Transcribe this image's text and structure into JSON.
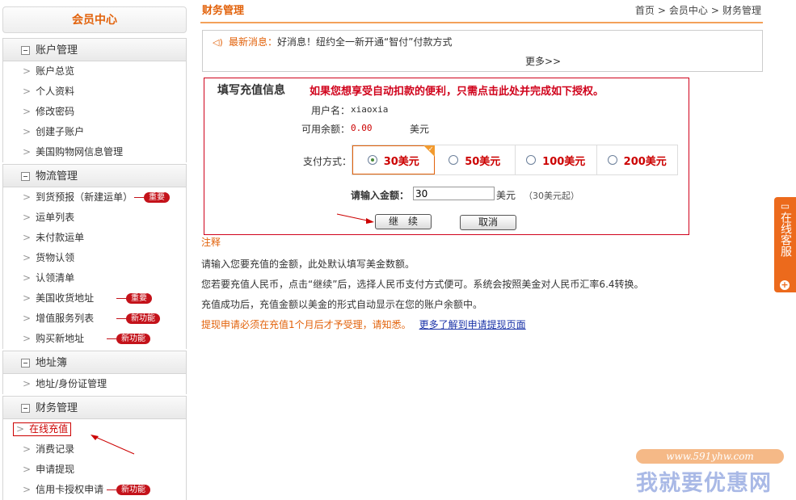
{
  "sidebar": {
    "title": "会员中心",
    "sections": [
      {
        "header": "账户管理",
        "items": [
          "账户总览",
          "个人资料",
          "修改密码",
          "创建子账户",
          "美国购物网信息管理"
        ]
      },
      {
        "header": "物流管理",
        "items": [
          "到货预报（新建运单）",
          "运单列表",
          "未付款运单",
          "货物认领",
          "认领清单",
          "美国收货地址",
          "增值服务列表",
          "购买新地址"
        ]
      },
      {
        "header": "地址簿",
        "items": [
          "地址/身份证管理"
        ]
      },
      {
        "header": "财务管理",
        "items": [
          "在线充值",
          "消费记录",
          "申请提现",
          "信用卡授权申请"
        ]
      }
    ],
    "badges": {
      "important": "重要",
      "new": "新功能"
    }
  },
  "page": {
    "title": "财务管理",
    "breadcrumb": [
      "首页",
      "会员中心",
      "财务管理"
    ]
  },
  "news": {
    "label": "最新消息：",
    "text": "好消息！纽约全一新开通“智付”付款方式",
    "more": "更多>>"
  },
  "form": {
    "title": "填写充值信息",
    "notice": "如果您想享受自动扣款的便利，只需点击此处并完成如下授权。",
    "username_label": "用户名：",
    "username": "xiaoxia",
    "balance_label": "可用余额：",
    "balance": "0.00",
    "balance_unit": "美元",
    "payment_label": "支付方式：",
    "options": [
      "30美元",
      "50美元",
      "100美元",
      "200美元"
    ],
    "selected_index": 0,
    "amount_label": "请输入金额：",
    "amount_value": "30",
    "amount_unit": "美元",
    "amount_hint": "（30美元起）",
    "continue_label": "继　续",
    "cancel_label": "取消"
  },
  "notes": {
    "title": "注释",
    "lines": [
      "请输入您要充值的金额，此处默认填写美金数额。",
      "您若要充值人民币，点击“继续”后，选择人民币支付方式便可。系统会按照美金对人民币汇率6.4转换。",
      "充值成功后，充值金额以美金的形式自动显示在您的账户余额中。"
    ],
    "warning": "提现申请必须在充值1个月后才予受理，请知悉。",
    "link": "更多了解到申请提现页面"
  },
  "service": {
    "label": "在线客服"
  },
  "watermark": {
    "url": "www.591yhw.com",
    "name": "我就要优惠网"
  },
  "colors": {
    "accent": "#e2620b",
    "alert": "#d0021b",
    "link": "#1a33a8"
  }
}
